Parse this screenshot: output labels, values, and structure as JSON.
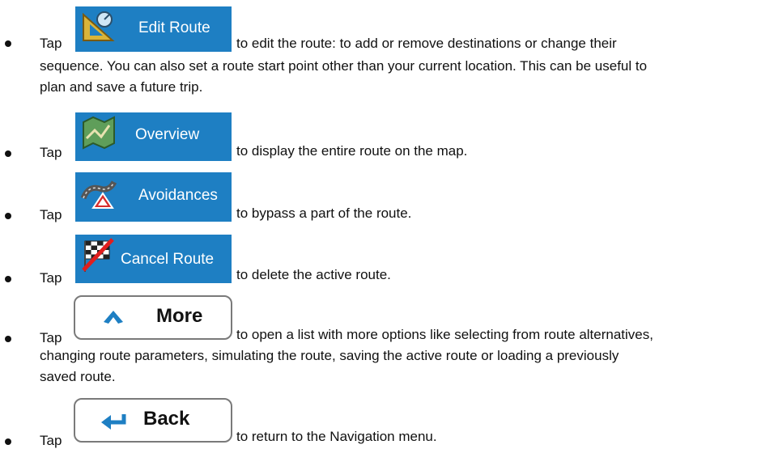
{
  "items": [
    {
      "tap": "Tap",
      "button": "Edit Route",
      "icon": "ruler-triangle-icon",
      "lines": [
        "to edit the route: to add or remove destinations or change their",
        "sequence. You can also set a route start point other than your current location. This can be useful to",
        "plan and save a future trip."
      ]
    },
    {
      "tap": "Tap",
      "button": "Overview",
      "icon": "map-icon",
      "lines": [
        "to display the entire route on the map."
      ]
    },
    {
      "tap": "Tap",
      "button": "Avoidances",
      "icon": "road-avoid-icon",
      "lines": [
        "to bypass a part of the route."
      ]
    },
    {
      "tap": "Tap",
      "button": "Cancel Route",
      "icon": "checkered-flag-crossed-icon",
      "lines": [
        "to delete the active route."
      ]
    },
    {
      "tap": "Tap",
      "button": "More",
      "icon": "chevron-up-icon",
      "lines": [
        "to open a list with more options like selecting from route alternatives,",
        "changing route parameters, simulating the route, saving the active route or loading a previously",
        "saved route."
      ]
    },
    {
      "tap": "Tap",
      "button": "Back",
      "icon": "back-arrow-icon",
      "lines": [
        "to return to the Navigation menu."
      ]
    }
  ],
  "colors": {
    "button_blue": "#1e7fc3",
    "text": "#111111"
  }
}
